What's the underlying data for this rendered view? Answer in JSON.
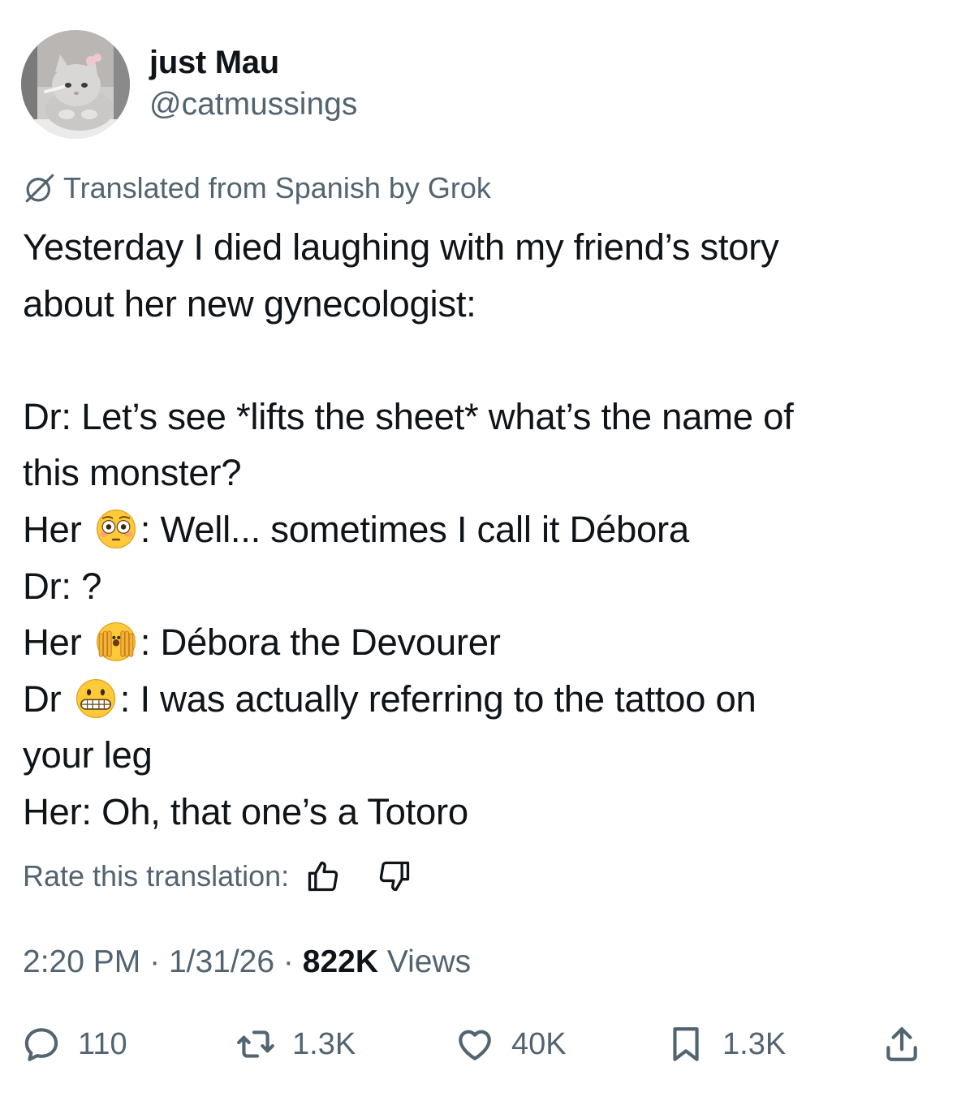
{
  "user": {
    "name": "just Mau",
    "handle": "@catmussings"
  },
  "translation": {
    "note": "Translated from Spanish by Grok",
    "icon": "grok-icon"
  },
  "tweet": {
    "lines": [
      "Yesterday I died laughing with my friend’s story",
      "about her new gynecologist:",
      "",
      "Dr: Let’s see *lifts the sheet* what’s the name of",
      "this monster?",
      "Dr: ?",
      "your leg",
      "Her: Oh, that one’s a Totoro"
    ],
    "her1_prefix": "Her",
    "her1_text": ": Well... sometimes I call it Débora",
    "her2_prefix": "Her",
    "her2_text": ": Débora the Devourer",
    "dr_prefix": "Dr",
    "dr_text": ": I was actually referring to the tattoo on",
    "emojis": [
      "flushed-face",
      "face-with-hands-over-face",
      "grimacing-face"
    ]
  },
  "rate": {
    "label": "Rate this translation:",
    "icons": [
      "thumbs-up-icon",
      "thumbs-down-icon"
    ]
  },
  "meta": {
    "time": "2:20 PM",
    "date": "1/31/26",
    "views_count": "822K",
    "views_label": "Views",
    "separator": "·"
  },
  "actions": {
    "replies": "110",
    "reposts": "1.3K",
    "likes": "40K",
    "bookmarks": "1.3K"
  },
  "colors": {
    "text": "#0f1419",
    "secondary": "#536471",
    "background": "#ffffff"
  }
}
